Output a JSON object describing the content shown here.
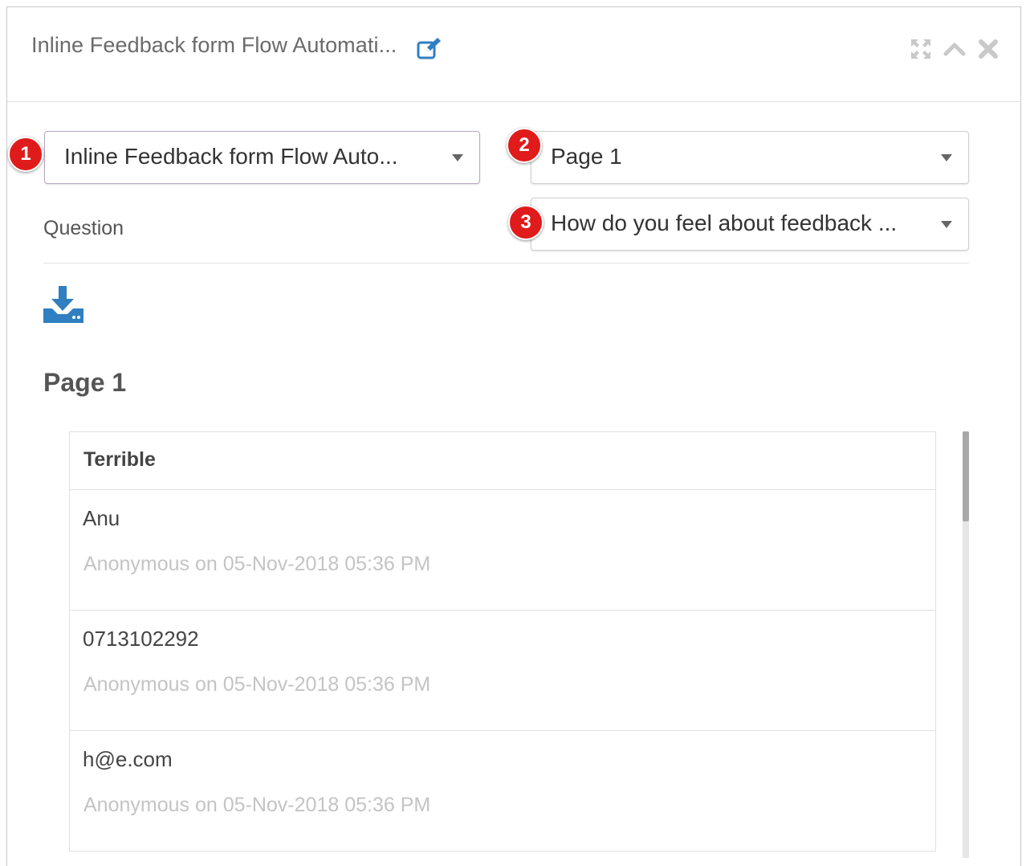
{
  "header": {
    "title": "Inline Feedback form Flow Automati...",
    "icons": [
      "edit-icon",
      "expand-icon",
      "collapse-icon",
      "close-icon"
    ]
  },
  "selectors": {
    "form": {
      "badge": "1",
      "value": "Inline Feedback form Flow Auto..."
    },
    "page": {
      "badge": "2",
      "value": "Page 1"
    },
    "question": {
      "badge": "3",
      "value": "How do you feel about feedback ..."
    }
  },
  "question_label": "Question",
  "page_heading": "Page 1",
  "results": {
    "header": "Terrible",
    "rows": [
      {
        "answer": "Anu",
        "meta": "Anonymous on 05-Nov-2018 05:36 PM"
      },
      {
        "answer": "0713102292",
        "meta": "Anonymous on 05-Nov-2018 05:36 PM"
      },
      {
        "answer": "h@e.com",
        "meta": "Anonymous on 05-Nov-2018 05:36 PM"
      }
    ]
  },
  "colors": {
    "accent": "#2f7fc1",
    "badge": "#e01b1b",
    "muted_text": "#c4c4c4"
  }
}
